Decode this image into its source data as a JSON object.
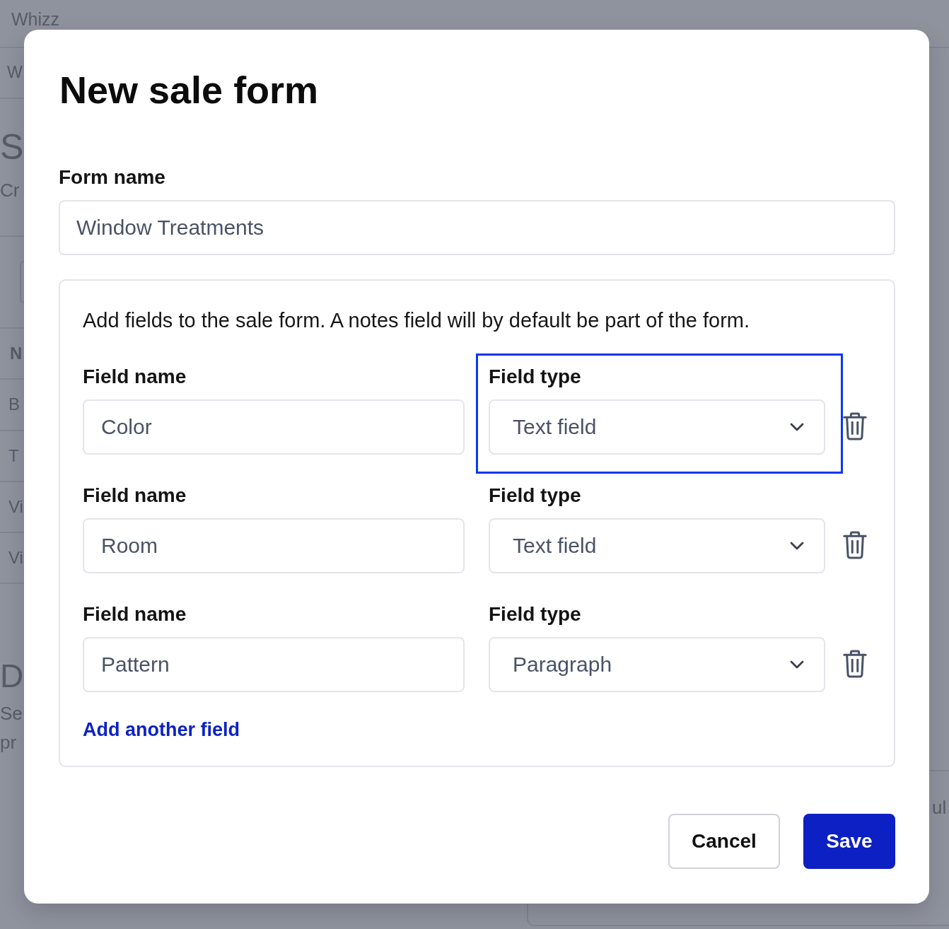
{
  "background_page": {
    "app_name": "Whizz",
    "nav_item": "W",
    "page_title": "S",
    "page_subtitle": "Cr",
    "table": {
      "header": "N",
      "rows": [
        "B",
        "T",
        "Vi",
        "Vi"
      ]
    },
    "section_title": "D",
    "section_text": [
      "Se",
      "pr"
    ],
    "side_text": "ul"
  },
  "dialog": {
    "title": "New sale form",
    "form_name": {
      "label": "Form name",
      "value": "Window Treatments"
    },
    "fields_panel": {
      "description": "Add fields to the sale form. A notes field will by default be part of the form.",
      "rows": [
        {
          "name_label": "Field name",
          "name_value": "Color",
          "type_label": "Field type",
          "type_value": "Text field",
          "highlighted": true
        },
        {
          "name_label": "Field name",
          "name_value": "Room",
          "type_label": "Field type",
          "type_value": "Text field",
          "highlighted": false
        },
        {
          "name_label": "Field name",
          "name_value": "Pattern",
          "type_label": "Field type",
          "type_value": "Paragraph",
          "highlighted": false
        }
      ],
      "add_link": "Add another field"
    },
    "buttons": [
      {
        "label": "Cancel",
        "kind": "secondary"
      },
      {
        "label": "Save",
        "kind": "primary"
      }
    ]
  }
}
